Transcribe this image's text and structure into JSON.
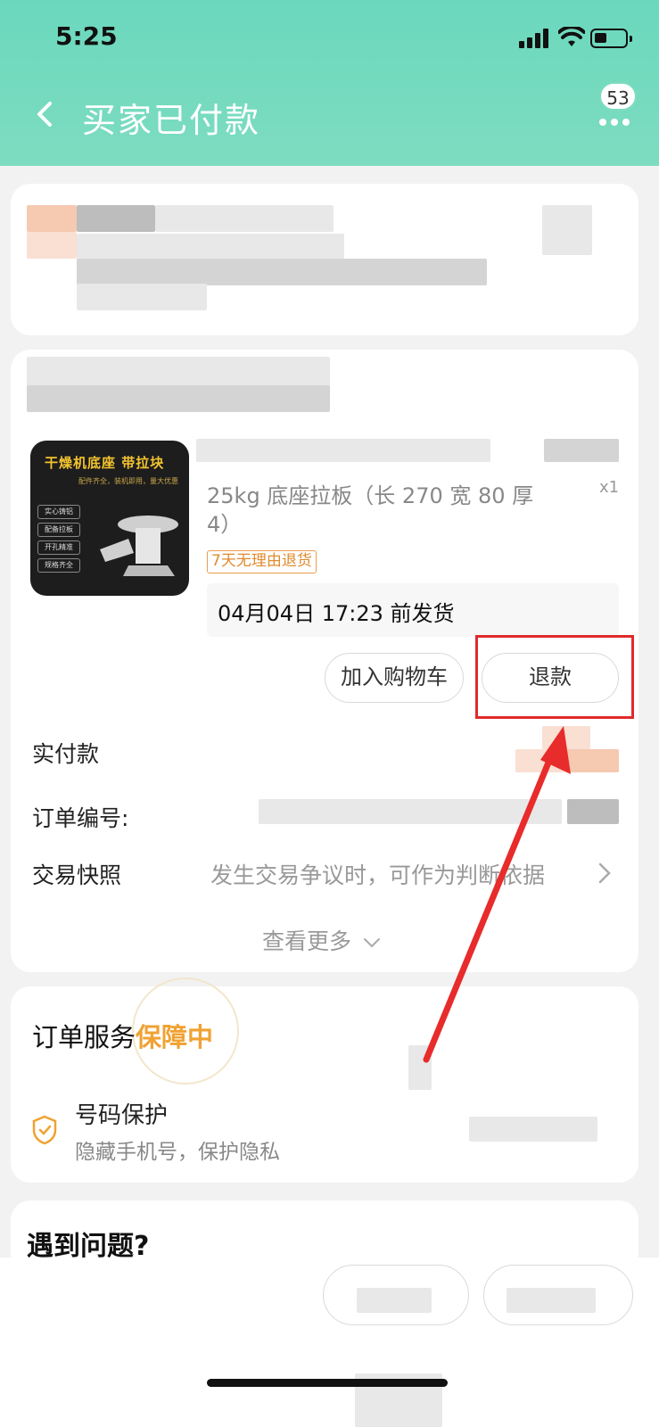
{
  "status_bar": {
    "time": "5:25"
  },
  "nav": {
    "title": "买家已付款",
    "badge_count": "53"
  },
  "product": {
    "image_title": "干燥机底座 带拉块",
    "image_subtitle": "配件齐全，装机即用，量大优惠",
    "image_tags": [
      "实心铸铝",
      "配备拉板",
      "开孔精准",
      "规格齐全"
    ],
    "description": "25kg 底座拉板（长 270 宽 80 厚 4）",
    "quantity": "x1",
    "return_tag": "7天无理由退货",
    "ship_deadline": "04月04日 17:23 前发货"
  },
  "actions": {
    "add_to_cart": "加入购物车",
    "refund": "退款"
  },
  "order_info": {
    "paid_label": "实付款",
    "order_no_label": "订单编号:",
    "snapshot_label": "交易快照",
    "snapshot_hint": "发生交易争议时，可作为判断依据",
    "see_more": "查看更多"
  },
  "service": {
    "title_prefix": "订单服务",
    "title_highlight": "保障中",
    "item_name": "号码保护",
    "item_desc": "隐藏手机号，保护隐私"
  },
  "problem": {
    "text": "遇到问题?"
  },
  "colors": {
    "header": "#6bd8bd",
    "accent_orange": "#f0a233",
    "highlight_red": "#e02a2a"
  }
}
